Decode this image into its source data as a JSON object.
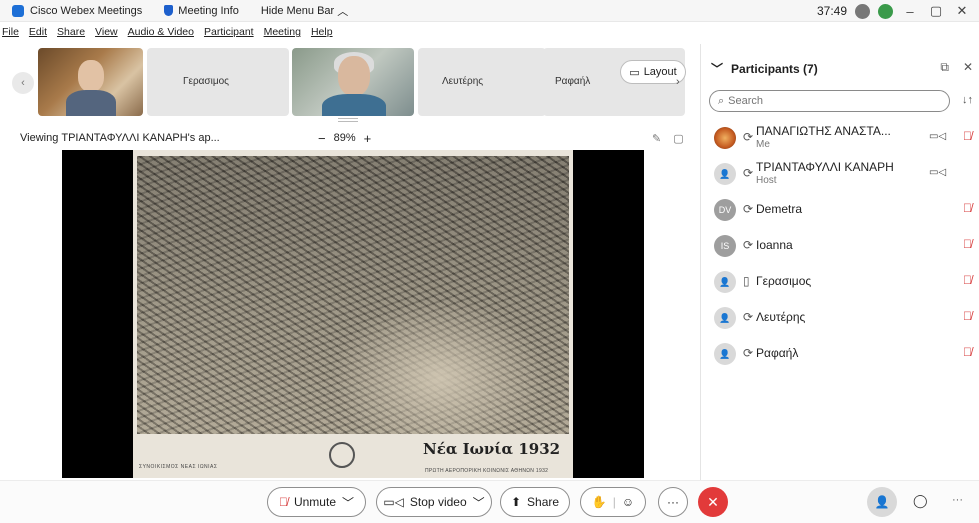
{
  "titlebar": {
    "app_name": "Cisco Webex Meetings",
    "meeting_info": "Meeting Info",
    "hide_menu": "Hide Menu Bar",
    "timer": "37:49",
    "minimize": "–",
    "restore": "▢",
    "close": "✕"
  },
  "menubar": [
    "File",
    "Edit",
    "Share",
    "View",
    "Audio & Video",
    "Participant",
    "Meeting",
    "Help"
  ],
  "strip": {
    "tiles": [
      "Γερασιμος",
      "Λευτέρης",
      "Ραφαήλ"
    ],
    "layout_label": "Layout"
  },
  "viewbar": {
    "viewing": "Viewing ΤΡΙΑΝΤΑΦΥΛΛΙ ΚΑΝΑΡΗ's ap...",
    "zoom_minus": "−",
    "zoom": "89%",
    "zoom_plus": "+"
  },
  "shared": {
    "caption": "Νέα Ιωνία 1932",
    "small_left": "ΣΥΝΟΙΚΙΣΜΟΣ ΝΕΑΣ ΙΩΝΙΑΣ",
    "small_right": "ΠΡΩΤΗ ΑΕΡΟΠΟΡΙΚΗ ΚΟΙΝΩΝΙΣ ΑΘΗΝΩΝ 1932"
  },
  "panel": {
    "title": "Participants (7)",
    "search_placeholder": "Search",
    "participants": [
      {
        "name": "ΠΑΝΑΓΙΩΤΗΣ ΑΝΑΣΤΑ...",
        "role": "Me",
        "initials": "",
        "avatar_color": "#c45a20",
        "device": "audio",
        "camera": true,
        "muted": true
      },
      {
        "name": "ΤΡΙΑΝΤΑΦΥΛΛΙ ΚΑΝΑΡΗ",
        "role": "Host",
        "initials": "",
        "avatar_color": "#d9d9d9",
        "device": "audio",
        "camera": true,
        "muted": false
      },
      {
        "name": "Demetra",
        "role": "",
        "initials": "DV",
        "avatar_color": "#9e9e9e",
        "device": "audio",
        "camera": false,
        "muted": true
      },
      {
        "name": "Ioanna",
        "role": "",
        "initials": "IS",
        "avatar_color": "#9e9e9e",
        "device": "audio",
        "camera": false,
        "muted": true
      },
      {
        "name": "Γερασιμος",
        "role": "",
        "initials": "",
        "avatar_color": "#d9d9d9",
        "device": "phone",
        "camera": false,
        "muted": true
      },
      {
        "name": "Λευτέρης",
        "role": "",
        "initials": "",
        "avatar_color": "#d9d9d9",
        "device": "audio",
        "camera": false,
        "muted": true
      },
      {
        "name": "Ραφαήλ",
        "role": "",
        "initials": "",
        "avatar_color": "#d9d9d9",
        "device": "audio",
        "camera": false,
        "muted": true
      }
    ]
  },
  "toolbar": {
    "unmute": "Unmute",
    "stop_video": "Stop video",
    "share": "Share",
    "more": "···"
  },
  "colors": {
    "accent": "#1d6fd6",
    "leave": "#e23a3a",
    "muted_red": "#d63a3a"
  }
}
